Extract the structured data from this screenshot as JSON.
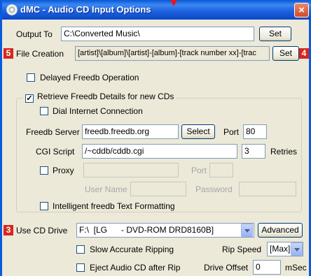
{
  "window": {
    "title": "dMC - Audio CD Input Options",
    "close": "×"
  },
  "output": {
    "label": "Output To",
    "value": "C:\\Converted Music\\",
    "set_label": "Set"
  },
  "file_creation": {
    "badge": "5",
    "label": "File Creation",
    "value": "[artist]\\[album]\\[artist]-[album]-[track number xx]-[trac",
    "set_label": "Set",
    "set_badge": "4"
  },
  "delayed_freedb": {
    "label": "Delayed Freedb Operation",
    "checked": false
  },
  "freedb_group": {
    "retrieve_label": "Retrieve Freedb Details for new CDs",
    "retrieve_checked": true,
    "dial_label": "Dial Internet Connection",
    "server_label": "Freedb Server",
    "server_value": "freedb.freedb.org",
    "select_label": "Select",
    "port_label": "Port",
    "port_value": "80",
    "cgi_label": "CGI Script",
    "cgi_value": "/~cddb/cddb.cgi",
    "retries_value": "3",
    "retries_label": "Retries",
    "proxy_label": "Proxy",
    "proxy_port_label": "Port",
    "username_label": "User Name",
    "password_label": "Password",
    "intelligent_label": "Intelligent freedb Text Formatting"
  },
  "cd_drive": {
    "badge": "3",
    "label": "Use CD Drive",
    "value": "F:\\  [LG      - DVD-ROM DRD8160B]",
    "advanced_label": "Advanced"
  },
  "ripping": {
    "slow_label": "Slow Accurate Ripping",
    "eject_label": "Eject Audio CD after Rip",
    "speed_label": "Rip Speed",
    "speed_value": "[Max]",
    "offset_label": "Drive Offset",
    "offset_value": "0",
    "offset_unit": "mSec"
  },
  "colors": {
    "titlebar": "#0a58d6",
    "badge": "#d9261c",
    "window_bg": "#ece9d8"
  }
}
